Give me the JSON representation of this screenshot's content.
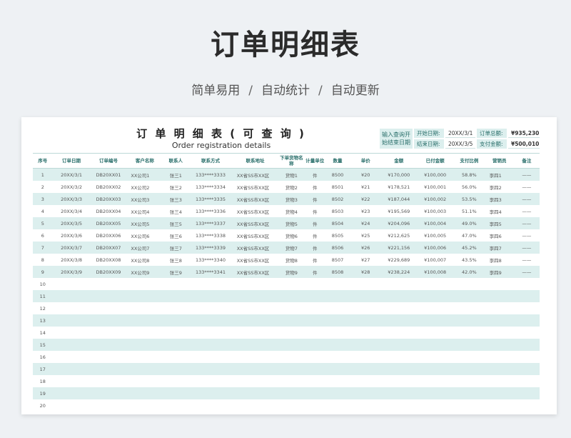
{
  "page": {
    "title": "订单明细表",
    "subtitle_parts": [
      "简单易用",
      "自动统计",
      "自动更新"
    ],
    "separator": "/"
  },
  "sheet": {
    "title": "订 单 明 细 表 ( 可 查 询 )",
    "subtitle": "Order registration details",
    "query": {
      "input_label": "输入查询开始结束日期",
      "start_label": "开始日期:",
      "start_value": "20XX/3/1",
      "end_label": "结束日期:",
      "end_value": "20XX/3/5",
      "total_label": "订单总额:",
      "total_value": "¥935,230",
      "paid_label": "支付金额:",
      "paid_value": "¥500,010"
    },
    "columns": [
      "序号",
      "订单日期",
      "订单编号",
      "客户名称",
      "联系人",
      "联系方式",
      "联系地址",
      "下单货物名称",
      "计量单位",
      "数量",
      "单价",
      "金额",
      "已付金额",
      "支付比例",
      "营销员",
      "备注"
    ],
    "rows": [
      [
        "1",
        "20XX/3/1",
        "DB20XX01",
        "XX公司1",
        "张三1",
        "133****3333",
        "XX省SS市XX区",
        "货物1",
        "件",
        "8500",
        "¥20",
        "¥170,000",
        "¥100,000",
        "58.8%",
        "李四1",
        "——"
      ],
      [
        "2",
        "20XX/3/2",
        "DB20XX02",
        "XX公司2",
        "张三2",
        "133****3334",
        "XX省SS市XX区",
        "货物2",
        "件",
        "8501",
        "¥21",
        "¥178,521",
        "¥100,001",
        "56.0%",
        "李四2",
        "——"
      ],
      [
        "3",
        "20XX/3/3",
        "DB20XX03",
        "XX公司3",
        "张三3",
        "133****3335",
        "XX省SS市XX区",
        "货物3",
        "件",
        "8502",
        "¥22",
        "¥187,044",
        "¥100,002",
        "53.5%",
        "李四3",
        "——"
      ],
      [
        "4",
        "20XX/3/4",
        "DB20XX04",
        "XX公司4",
        "张三4",
        "133****3336",
        "XX省SS市XX区",
        "货物4",
        "件",
        "8503",
        "¥23",
        "¥195,569",
        "¥100,003",
        "51.1%",
        "李四4",
        "——"
      ],
      [
        "5",
        "20XX/3/5",
        "DB20XX05",
        "XX公司5",
        "张三5",
        "133****3337",
        "XX省SS市XX区",
        "货物5",
        "件",
        "8504",
        "¥24",
        "¥204,096",
        "¥100,004",
        "49.0%",
        "李四5",
        "——"
      ],
      [
        "6",
        "20XX/3/6",
        "DB20XX06",
        "XX公司6",
        "张三6",
        "133****3338",
        "XX省SS市XX区",
        "货物6",
        "件",
        "8505",
        "¥25",
        "¥212,625",
        "¥100,005",
        "47.0%",
        "李四6",
        "——"
      ],
      [
        "7",
        "20XX/3/7",
        "DB20XX07",
        "XX公司7",
        "张三7",
        "133****3339",
        "XX省SS市XX区",
        "货物7",
        "件",
        "8506",
        "¥26",
        "¥221,156",
        "¥100,006",
        "45.2%",
        "李四7",
        "——"
      ],
      [
        "8",
        "20XX/3/8",
        "DB20XX08",
        "XX公司8",
        "张三8",
        "133****3340",
        "XX省SS市XX区",
        "货物8",
        "件",
        "8507",
        "¥27",
        "¥229,689",
        "¥100,007",
        "43.5%",
        "李四8",
        "——"
      ],
      [
        "9",
        "20XX/3/9",
        "DB20XX09",
        "XX公司9",
        "张三9",
        "133****3341",
        "XX省SS市XX区",
        "货物9",
        "件",
        "8508",
        "¥28",
        "¥238,224",
        "¥100,008",
        "42.0%",
        "李四9",
        "——"
      ],
      [
        "10"
      ],
      [
        "11"
      ],
      [
        "12"
      ],
      [
        "13"
      ],
      [
        "14"
      ],
      [
        "15"
      ],
      [
        "16"
      ],
      [
        "17"
      ],
      [
        "18"
      ],
      [
        "19"
      ],
      [
        "20"
      ]
    ]
  },
  "colors": {
    "accent": "#2a6f6b",
    "row_stripe": "#dcefee",
    "background": "#eef1f4"
  }
}
